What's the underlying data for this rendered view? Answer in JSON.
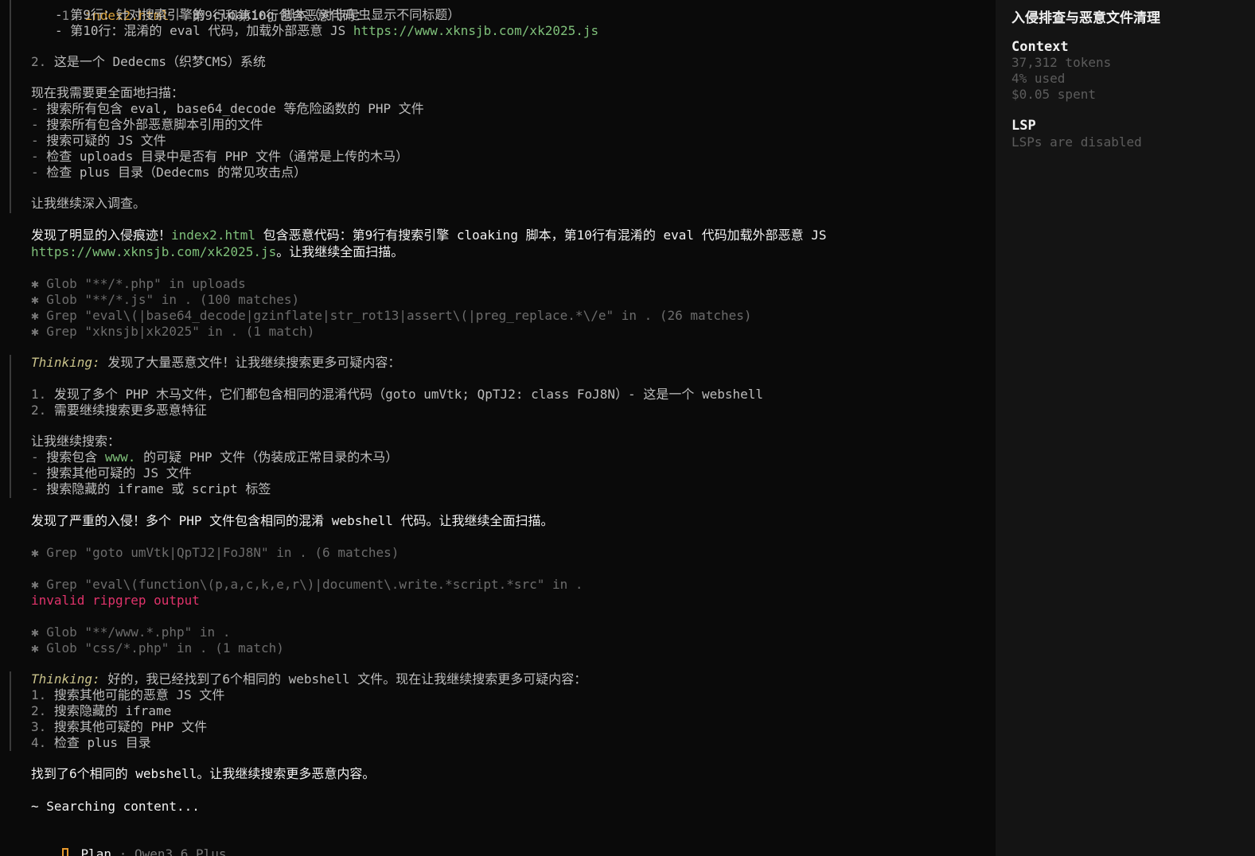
{
  "main": {
    "line_top_partial": {
      "num": "1.",
      "file": "index2.html",
      "rest": " - 第9行和第10行包含恶意代码："
    },
    "items_top": [
      "- 第9行：针对搜索引擎的 cloaking 脚本（对非爬虫显示不同标题）",
      "- 第10行：混淆的 eval 代码，加载外部恶意 JS "
    ],
    "url": "https://www.xknsjb.com/xk2025.js",
    "item2_num": "2.",
    "item2_text": " 这是一个 Dedecms（织梦CMS）系统",
    "scan_intro": "现在我需要更全面地扫描：",
    "scan_list": [
      "搜索所有包含 eval, base64_decode 等危险函数的 PHP 文件",
      "搜索所有包含外部恶意脚本引用的文件",
      "搜索可疑的 JS 文件",
      "检查 uploads 目录中是否有 PHP 文件（通常是上传的木马）",
      "检查 plus 目录（Dedecms 的常见攻击点）"
    ],
    "dash": "- ",
    "continue1": "让我继续深入调查。",
    "found1_a": "发现了明显的入侵痕迹！",
    "found1_file": "index2.html",
    "found1_b": " 包含恶意代码：第9行有搜索引擎 cloaking 脚本，第10行有混淆的 eval 代码加载外部恶意 JS",
    "found1_url": "https://www.xknsjb.com/xk2025.js",
    "found1_c": "。让我继续全面扫描。",
    "tools1": [
      "Glob \"**/*.php\" in uploads",
      "Glob \"**/*.js\" in . (100 matches)",
      "Grep \"eval\\(|base64_decode|gzinflate|str_rot13|assert\\(|preg_replace.*\\/e\" in . (26 matches)",
      "Grep \"xknsjb|xk2025\" in . (1 match)"
    ],
    "tool_mark": "✱ ",
    "thinking_label": "Thinking:",
    "thinking1": " 发现了大量恶意文件！让我继续搜索更多可疑内容：",
    "t1_list": [
      {
        "num": "1.",
        "text": " 发现了多个 PHP 木马文件，它们都包含相同的混淆代码（goto umVtk; QpTJ2: class FoJ8N）- 这是一个 webshell"
      },
      {
        "num": "2.",
        "text": " 需要继续搜索更多恶意特征"
      }
    ],
    "continue2": "让我继续搜索：",
    "t1_search_a": "搜索包含 ",
    "t1_search_www": "www.",
    "t1_search_b": " 的可疑 PHP 文件（伪装成正常目录的木马）",
    "t1_search_2": "搜索其他可疑的 JS 文件",
    "t1_search_3": "搜索隐藏的 iframe 或 script 标签",
    "found2": "发现了严重的入侵！多个 PHP 文件包含相同的混淆 webshell 代码。让我继续全面扫描。",
    "tool2": "Grep \"goto umVtk|QpTJ2|FoJ8N\" in . (6 matches)",
    "tool3": "Grep \"eval\\(function\\(p,a,c,k,e,r\\)|document\\.write.*script.*src\" in .",
    "error": "invalid ripgrep output",
    "tools4": [
      "Glob \"**/www.*.php\" in .",
      "Glob \"css/*.php\" in . (1 match)"
    ],
    "thinking2": " 好的，我已经找到了6个相同的 webshell 文件。现在让我继续搜索更多可疑内容：",
    "t2_list": [
      {
        "num": "1.",
        "text": " 搜索其他可能的恶意 JS 文件"
      },
      {
        "num": "2.",
        "text": " 搜索隐藏的 iframe"
      },
      {
        "num": "3.",
        "text": " 搜索其他可疑的 PHP 文件"
      },
      {
        "num": "4.",
        "text": " 检查 plus 目录"
      }
    ],
    "found3": "找到了6个相同的 webshell。让我继续搜索更多恶意内容。",
    "status": "~ Searching content...",
    "mode": "Plan",
    "sep": " · ",
    "model": "Qwen3.6 Plus"
  },
  "sidebar": {
    "title": "入侵排查与恶意文件清理",
    "context_label": "Context",
    "tokens": "37,312 tokens",
    "used": "4% used",
    "spent": "$0.05 spent",
    "lsp_label": "LSP",
    "lsp_status": "LSPs are disabled"
  },
  "colors": {
    "background": "#0a0a0a",
    "sidebar": "#141414",
    "green": "#7fc07a",
    "orange": "#d9a13a",
    "error": "#e0336b"
  }
}
